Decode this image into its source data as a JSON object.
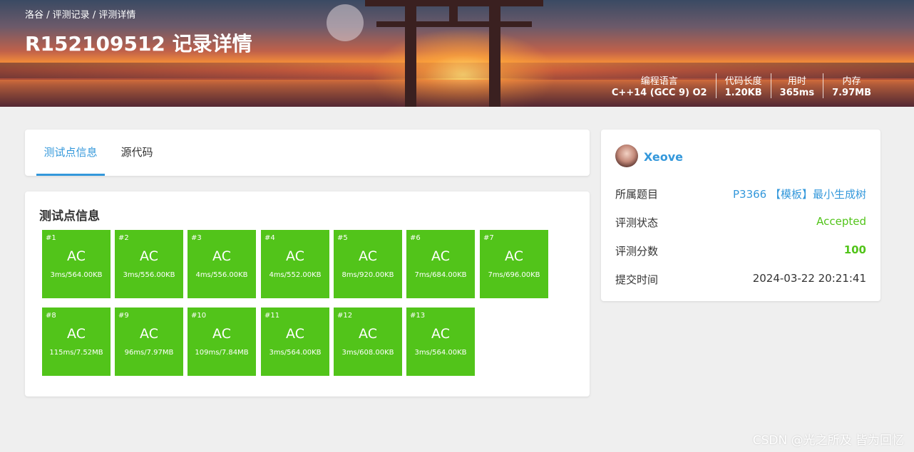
{
  "breadcrumb": {
    "part1": "洛谷",
    "sep1": " / ",
    "part2": "评测记录",
    "sep2": " / ",
    "part3": "评测详情"
  },
  "title": "R152109512 记录详情",
  "stats": [
    {
      "label": "编程语言",
      "value": "C++14 (GCC 9) O2"
    },
    {
      "label": "代码长度",
      "value": "1.20KB"
    },
    {
      "label": "用时",
      "value": "365ms"
    },
    {
      "label": "内存",
      "value": "7.97MB"
    }
  ],
  "tabs": [
    {
      "label": "测试点信息"
    },
    {
      "label": "源代码"
    }
  ],
  "cases_title": "测试点信息",
  "colors": {
    "ac": "#52c41a",
    "link": "#3498db"
  },
  "cases": [
    {
      "num": "#1",
      "status": "AC",
      "info": "3ms/564.00KB"
    },
    {
      "num": "#2",
      "status": "AC",
      "info": "3ms/556.00KB"
    },
    {
      "num": "#3",
      "status": "AC",
      "info": "4ms/556.00KB"
    },
    {
      "num": "#4",
      "status": "AC",
      "info": "4ms/552.00KB"
    },
    {
      "num": "#5",
      "status": "AC",
      "info": "8ms/920.00KB"
    },
    {
      "num": "#6",
      "status": "AC",
      "info": "7ms/684.00KB"
    },
    {
      "num": "#7",
      "status": "AC",
      "info": "7ms/696.00KB"
    },
    {
      "num": "#8",
      "status": "AC",
      "info": "115ms/7.52MB"
    },
    {
      "num": "#9",
      "status": "AC",
      "info": "96ms/7.97MB"
    },
    {
      "num": "#10",
      "status": "AC",
      "info": "109ms/7.84MB"
    },
    {
      "num": "#11",
      "status": "AC",
      "info": "3ms/564.00KB"
    },
    {
      "num": "#12",
      "status": "AC",
      "info": "3ms/608.00KB"
    },
    {
      "num": "#13",
      "status": "AC",
      "info": "3ms/564.00KB"
    }
  ],
  "user": {
    "name": "Xeove",
    "avatar_icon": "user-avatar"
  },
  "details": {
    "problem_label": "所属题目",
    "problem_value": "P3366 【模板】最小生成树",
    "status_label": "评测状态",
    "status_value": "Accepted",
    "score_label": "评测分数",
    "score_value": "100",
    "time_label": "提交时间",
    "time_value": "2024-03-22 20:21:41"
  },
  "watermark": "CSDN @光之所及 皆为回忆"
}
